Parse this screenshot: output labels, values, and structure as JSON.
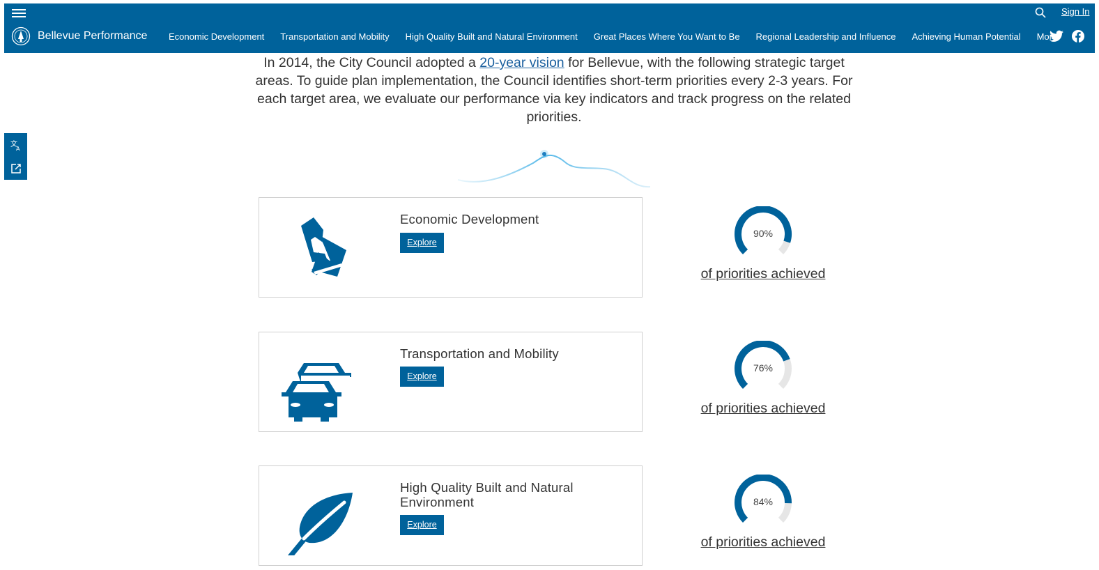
{
  "header": {
    "brand": "Bellevue Performance",
    "sign_in": "Sign In",
    "nav": [
      {
        "label": "Economic Development"
      },
      {
        "label": "Transportation and Mobility"
      },
      {
        "label": "High Quality Built and Natural Environment"
      },
      {
        "label": "Great Places Where You Want to Be"
      },
      {
        "label": "Regional Leadership and Influence"
      },
      {
        "label": "Achieving Human Potential"
      },
      {
        "label": "More"
      }
    ]
  },
  "intro": {
    "text_before": "In 2014, the City Council adopted a ",
    "link": "20-year vision",
    "text_after": " for Bellevue, with the following strategic target areas. To guide plan implementation, the Council identifies short-term priorities every 2-3 years. For each target area, we evaluate our performance via key indicators and track progress on the related priorities."
  },
  "areas": [
    {
      "title": "Economic Development",
      "explore": "Explore",
      "percent": 90,
      "percent_label": "90%",
      "caption": "of priorities achieved",
      "icon": "hand-money-icon"
    },
    {
      "title": "Transportation and Mobility",
      "explore": "Explore",
      "percent": 76,
      "percent_label": "76%",
      "caption": "of priorities achieved",
      "icon": "cars-icon"
    },
    {
      "title": "High Quality Built and Natural Environment",
      "explore": "Explore",
      "percent": 84,
      "percent_label": "84%",
      "caption": "of priorities achieved",
      "icon": "leaf-icon"
    }
  ],
  "colors": {
    "brand": "#00629b",
    "gauge_track": "#e6e6e6"
  }
}
